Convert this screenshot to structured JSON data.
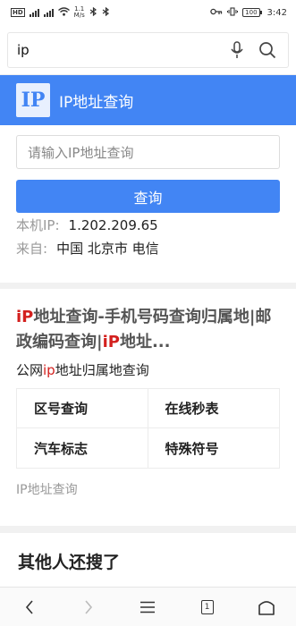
{
  "status_bar": {
    "hd": "HD",
    "network_speed_value": "1.1",
    "network_speed_unit": "M/s",
    "battery": "100",
    "time": "3:42"
  },
  "search": {
    "query": "ip",
    "mic_icon": "microphone-icon",
    "search_icon": "search-icon"
  },
  "banner": {
    "logo_text": "IP",
    "title": "IP地址查询"
  },
  "tool": {
    "input_placeholder": "请输入IP地址查询",
    "button_label": "查询",
    "local_ip_label": "本机IP:",
    "local_ip_value": "1.202.209.65",
    "from_label": "来自:",
    "from_value": "中国 北京市 电信"
  },
  "result": {
    "title_parts": [
      "iP",
      "地址查询-手机号码查询归属地|邮政编码查询|",
      "iP",
      "地址..."
    ],
    "subtitle_parts": [
      "公网",
      "ip",
      "地址归属地查询"
    ],
    "links": [
      "区号查询",
      "在线秒表",
      "汽车标志",
      "特殊符号"
    ],
    "source": "IP地址查询"
  },
  "others": {
    "heading": "其他人还搜了"
  },
  "bottom_nav": {
    "tab_count": "1",
    "icons": [
      "back-icon",
      "forward-icon",
      "menu-icon",
      "tabs-icon",
      "home-icon"
    ]
  },
  "colors": {
    "accent": "#4285f4",
    "highlight": "#d3201e"
  }
}
